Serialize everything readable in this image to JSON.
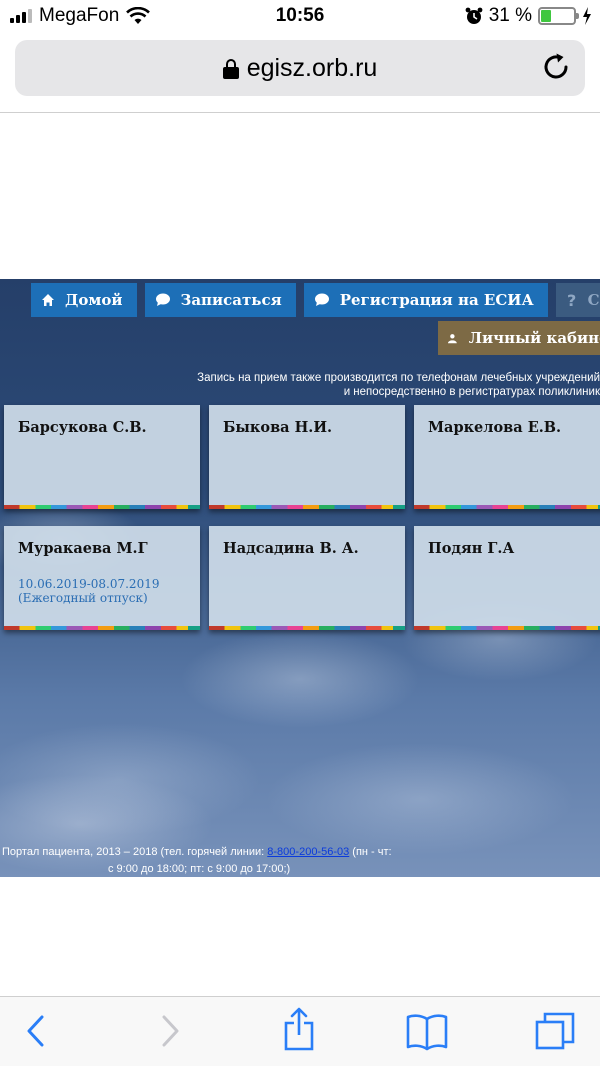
{
  "status": {
    "carrier": "MegaFon",
    "time": "10:56",
    "battery_text": "31 %",
    "battery_level": 0.31,
    "colors": {
      "battery": "#3fc73f"
    }
  },
  "browser": {
    "url": "egisz.orb.ru"
  },
  "nav": {
    "home": "Домой",
    "signup": "Записаться",
    "esia": "Регистрация на ЕСИА",
    "help": "Справка",
    "cabinet": "Личный кабинет"
  },
  "notice": {
    "line1": "Запись на прием также производится по телефонам лечебных учреждений",
    "line2": "и непосредственно в регистратурах поликлиник"
  },
  "doctors": [
    {
      "name": "Барсукова С.В.",
      "note1": "",
      "note2": ""
    },
    {
      "name": "Быкова Н.И.",
      "note1": "",
      "note2": ""
    },
    {
      "name": "Маркелова Е.В.",
      "note1": "",
      "note2": ""
    },
    {
      "name": "Муракаева М.Г",
      "note1": "10.06.2019-08.07.2019",
      "note2": "(Ежегодный отпуск)"
    },
    {
      "name": "Надсадина В. А.",
      "note1": "",
      "note2": ""
    },
    {
      "name": "Подян Г.А",
      "note1": "",
      "note2": ""
    }
  ],
  "footer": {
    "prefix": "Портал пациента, 2013 – 2018 (тел. горячей линии: ",
    "phone": "8-800-200-56-03",
    "suffix": " (пн - чт:",
    "line2": "с 9:00 до 18:00; пт: с 9:00 до 17:00;)"
  },
  "colors": {
    "nav_button": "#1d6fb7",
    "cabinet_button": "#7d6a45",
    "card_bg": "#cedbe8",
    "note_text": "#2a6db3"
  },
  "icons": {
    "home": "house-icon",
    "signup": "speech-bubble-icon",
    "esia": "speech-bubble-icon",
    "help": "question-icon",
    "cabinet": "user-icon"
  }
}
